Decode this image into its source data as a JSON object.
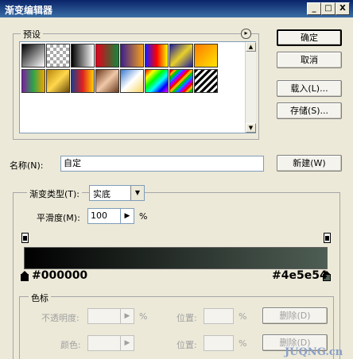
{
  "window": {
    "title": "渐变编辑器",
    "minimize_glyph": "_",
    "maximize_glyph": "□",
    "close_glyph": "X"
  },
  "presets": {
    "label": "预设",
    "menu_glyph": "▸",
    "scroll_up_glyph": "▲",
    "scroll_down_glyph": "▼",
    "swatches": [
      "linear-gradient(135deg,#000,#fff)",
      "repeating-conic-gradient(#aaa 0% 25%, #fff 0% 50%) 0 0/8px 8px",
      "linear-gradient(90deg,#000,#fff)",
      "linear-gradient(90deg,#e3001b,#11883a)",
      "linear-gradient(90deg,#3b1e8f,#f5a01a)",
      "linear-gradient(90deg,#1a1aff,#ff0000,#ffff00)",
      "linear-gradient(135deg,#1c1ca0,#e8d02a,#1c1ca0)",
      "linear-gradient(135deg,#ff7a00,#ffe600)",
      "linear-gradient(90deg,#7b1fa2,#2ea54a,#f4a300)",
      "linear-gradient(135deg,#b8860b,#ffd84d,#6b4a08)",
      "linear-gradient(90deg,#1f3c88,#e02020,#ffd200)",
      "linear-gradient(135deg,#6b3b1f,#f0c8a8,#6b3b1f)",
      "linear-gradient(135deg,#3a7bd5,#fff,#f7d560)",
      "linear-gradient(135deg,#ff0000,#ffff00,#00ff00,#00ffff,#0000ff,#ff00ff)",
      "repeating-linear-gradient(135deg,#ff0000 0 3px,#ffaa00 3px 6px,#00c800 6px 9px,#0080ff 9px 12px,#a000ff 12px 15px)",
      "repeating-linear-gradient(135deg,#000 0 3px,#fff 3px 6px)"
    ]
  },
  "buttons": {
    "ok": "确定",
    "cancel": "取消",
    "load": "载入(L)...",
    "save": "存储(S)...",
    "new": "新建(W)",
    "delete_opacity": "删除(D)",
    "delete_color": "删除(D)"
  },
  "name_field": {
    "label": "名称(N):",
    "value": "自定"
  },
  "gradient_type": {
    "label": "渐变类型(T):",
    "value": "实底",
    "dropdown_glyph": "▼"
  },
  "smoothness": {
    "label": "平滑度(M):",
    "value": "100",
    "arrow_glyph": "▶",
    "unit": "%"
  },
  "gradient": {
    "start_color": "#000000",
    "end_color": "#4e5e54",
    "start_label": "#000000",
    "end_label": "#4e5e54"
  },
  "color_stops": {
    "group_label": "色标",
    "opacity_label": "不透明度:",
    "opacity_unit": "%",
    "opacity_position_label": "位置:",
    "opacity_position_unit": "%",
    "color_label": "颜色:",
    "color_position_label": "位置:",
    "color_position_unit": "%",
    "arrow_glyph": "▶"
  },
  "watermark": "JUQNG.cn"
}
